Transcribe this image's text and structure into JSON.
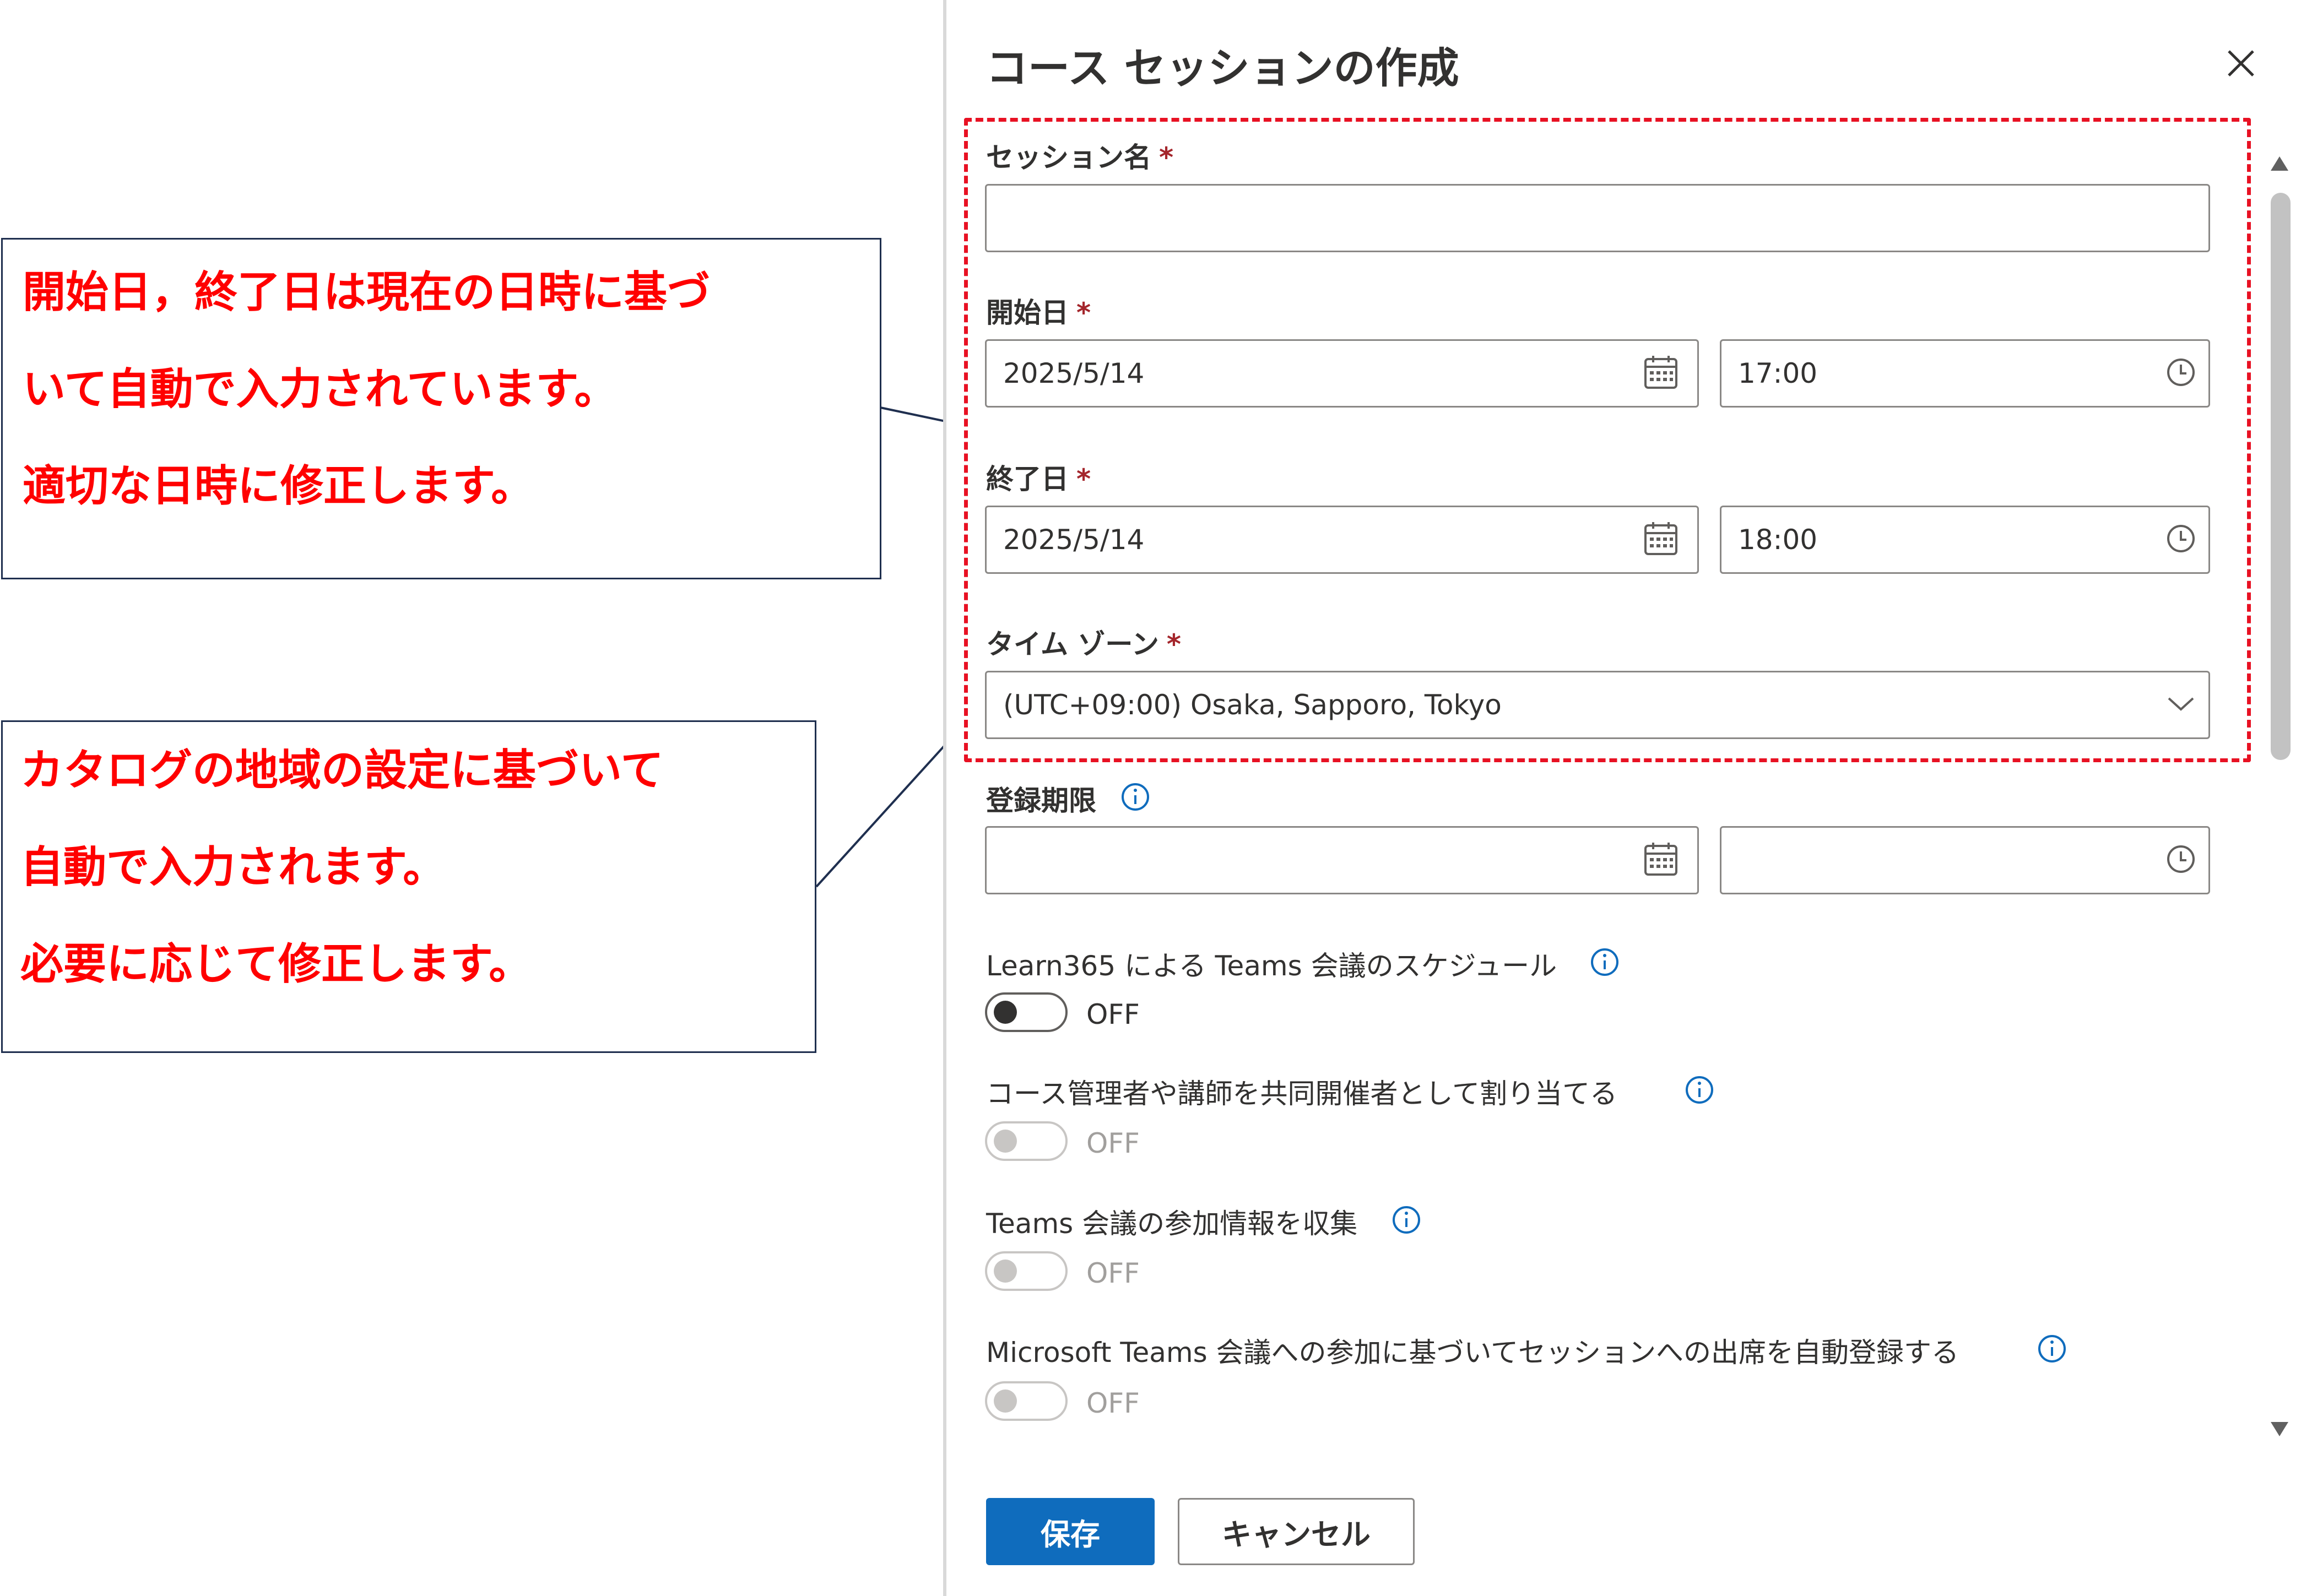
{
  "callouts": {
    "top": {
      "lines": [
        "開始日，終了日は現在の日時に基づ",
        "いて自動で入力されています。",
        "適切な日時に修正します。"
      ]
    },
    "bottom": {
      "lines": [
        "カタログの地域の設定に基づいて",
        "自動で入力されます。",
        "必要に応じて修正します。"
      ]
    }
  },
  "dialog": {
    "title": "コース セッションの作成",
    "session_name": {
      "label": "セッション名",
      "required_mark": "*",
      "value": ""
    },
    "start": {
      "label": "開始日",
      "required_mark": "*",
      "date": "2025/5/14",
      "time": "17:00"
    },
    "end": {
      "label": "終了日",
      "required_mark": "*",
      "date": "2025/5/14",
      "time": "18:00"
    },
    "timezone": {
      "label": "タイム ゾーン",
      "required_mark": "*",
      "value": "(UTC+09:00) Osaka, Sapporo, Tokyo"
    },
    "deadline": {
      "label": "登録期限",
      "date": "",
      "time": ""
    },
    "toggles": [
      {
        "label": "Learn365 による Teams 会議のスケジュール",
        "state": "OFF",
        "enabled": true
      },
      {
        "label": "コース管理者や講師を共同開催者として割り当てる",
        "state": "OFF",
        "enabled": false
      },
      {
        "label": "Teams 会議の参加情報を収集",
        "state": "OFF",
        "enabled": false
      },
      {
        "label": "Microsoft Teams 会議への参加に基づいてセッションへの出席を自動登録する",
        "state": "OFF",
        "enabled": false
      }
    ],
    "buttons": {
      "save": "保存",
      "cancel": "キャンセル"
    }
  },
  "colors": {
    "callout_text": "#ff0000",
    "highlight_border": "#e81123",
    "primary_button": "#0f6cbd",
    "info_icon": "#0f6cbd"
  },
  "icons": {
    "close": "close-icon",
    "calendar": "calendar-icon",
    "clock": "clock-icon",
    "chevron": "chevron-down-icon",
    "info": "info-icon"
  }
}
